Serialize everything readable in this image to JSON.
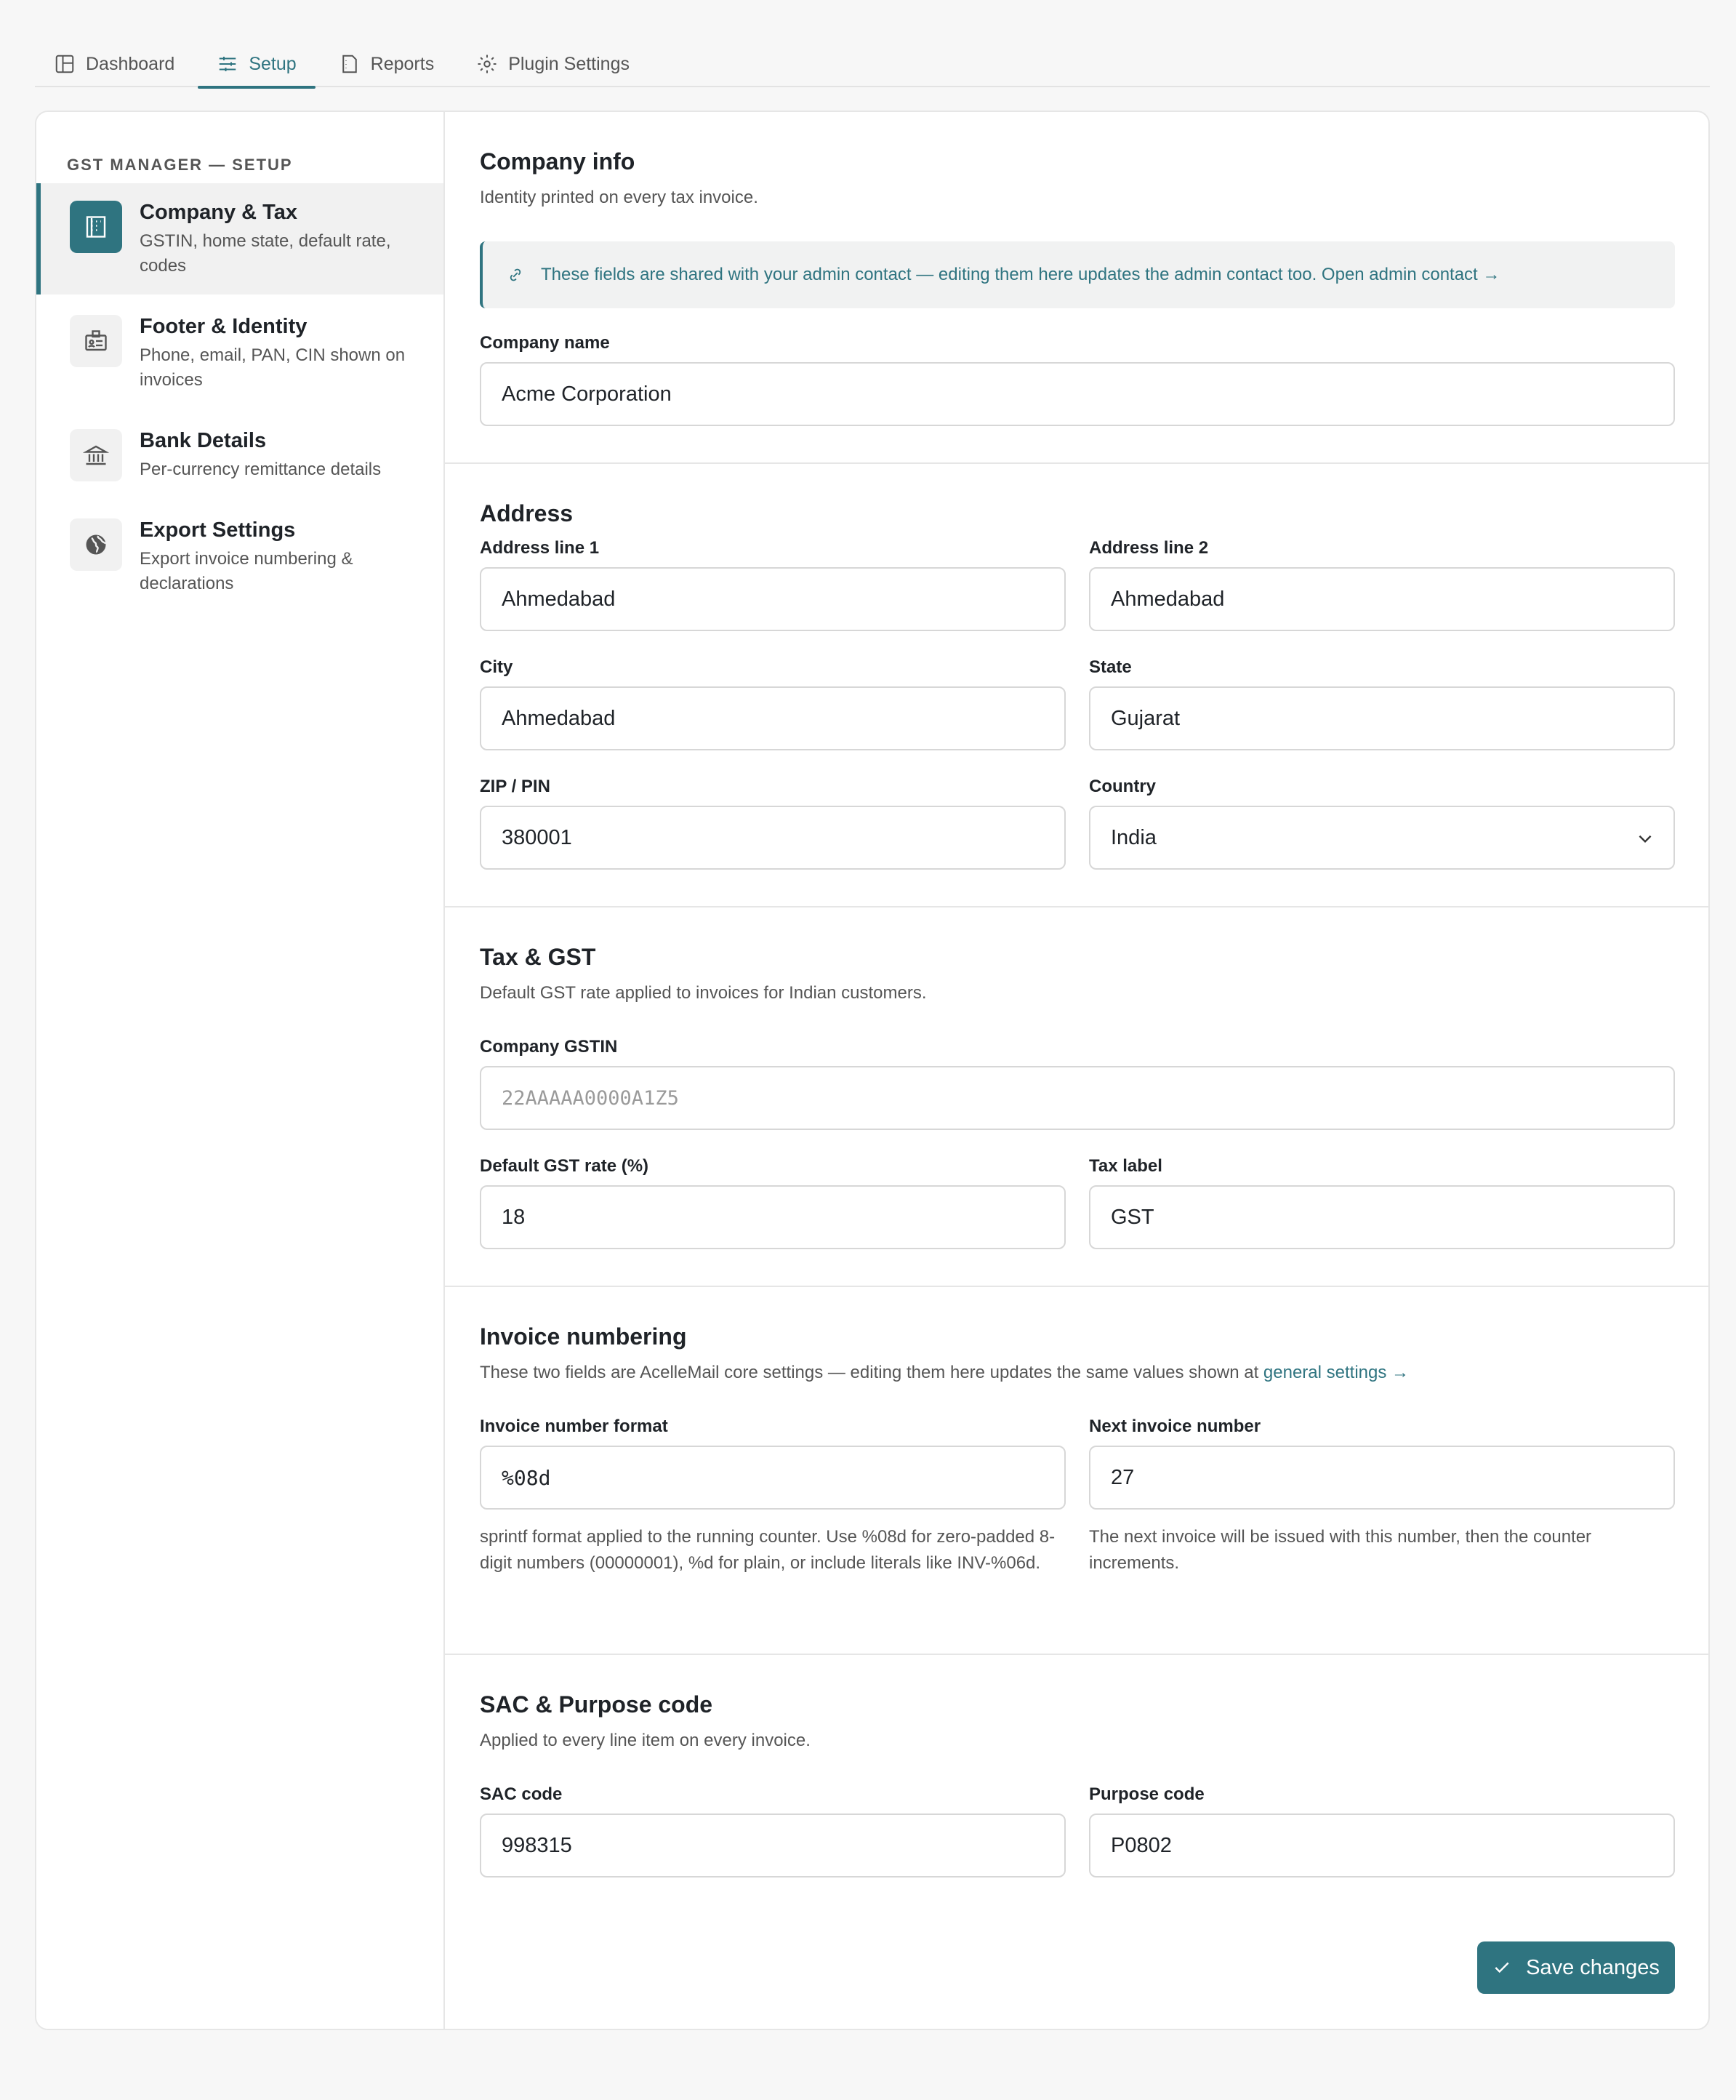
{
  "tabs": [
    {
      "label": "Dashboard",
      "icon": "layout-icon"
    },
    {
      "label": "Setup",
      "icon": "sliders-icon"
    },
    {
      "label": "Reports",
      "icon": "report-icon"
    },
    {
      "label": "Plugin Settings",
      "icon": "gear-icon"
    }
  ],
  "sidebar": {
    "title": "GST MANAGER — SETUP",
    "items": [
      {
        "label": "Company & Tax",
        "desc": "GSTIN, home state, default rate, codes",
        "icon": "building-icon"
      },
      {
        "label": "Footer & Identity",
        "desc": "Phone, email, PAN, CIN shown on invoices",
        "icon": "id-card-icon"
      },
      {
        "label": "Bank Details",
        "desc": "Per-currency remittance details",
        "icon": "bank-icon"
      },
      {
        "label": "Export Settings",
        "desc": "Export invoice numbering & declarations",
        "icon": "globe-icon"
      }
    ]
  },
  "company": {
    "title": "Company info",
    "subtitle": "Identity printed on every tax invoice.",
    "notice": "These fields are shared with your admin contact — editing them here updates the admin contact too. Open admin contact →",
    "name_label": "Company name",
    "name_value": "Acme Corporation"
  },
  "address": {
    "title": "Address",
    "line1_label": "Address line 1",
    "line1_value": "Ahmedabad",
    "line2_label": "Address line 2",
    "line2_value": "Ahmedabad",
    "city_label": "City",
    "city_value": "Ahmedabad",
    "state_label": "State",
    "state_value": "Gujarat",
    "zip_label": "ZIP / PIN",
    "zip_value": "380001",
    "country_label": "Country",
    "country_value": "India"
  },
  "tax": {
    "title": "Tax & GST",
    "subtitle": "Default GST rate applied to invoices for Indian customers.",
    "gstin_label": "Company GSTIN",
    "gstin_placeholder": "22AAAAA0000A1Z5",
    "rate_label": "Default GST rate (%)",
    "rate_value": "18",
    "taxlabel_label": "Tax label",
    "taxlabel_value": "GST"
  },
  "invoice": {
    "title": "Invoice numbering",
    "subtitle": "These two fields are AcelleMail core settings — editing them here updates the same values shown at",
    "subtitle_link": "general settings →",
    "format_label": "Invoice number format",
    "format_value": "%08d",
    "format_help": "sprintf format applied to the running counter. Use %08d for zero-padded 8-digit numbers (00000001), %d for plain, or include literals like INV-%06d.",
    "next_label": "Next invoice number",
    "next_value": "27",
    "next_help": "The next invoice will be issued with this number, then the counter increments."
  },
  "sac": {
    "title": "SAC & Purpose code",
    "subtitle": "Applied to every line item on every invoice.",
    "sac_label": "SAC code",
    "sac_value": "998315",
    "purpose_label": "Purpose code",
    "purpose_value": "P0802"
  },
  "actions": {
    "save_label": "Save changes"
  },
  "colors": {
    "accent": "#2f7480",
    "border": "#e6e6e6",
    "background": "#f7f7f7"
  }
}
